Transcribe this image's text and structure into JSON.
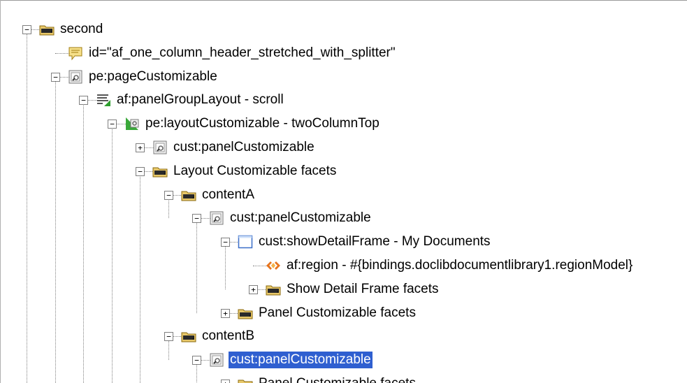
{
  "tree": {
    "nodes": [
      {
        "label": "second",
        "icon": "folder-facet-icon",
        "state": "expanded"
      },
      {
        "label": "id=\"af_one_column_header_stretched_with_splitter\"",
        "icon": "comment-icon",
        "state": "leaf"
      },
      {
        "label": "pe:pageCustomizable",
        "icon": "customizable-component-icon",
        "state": "expanded"
      },
      {
        "label": "af:panelGroupLayout - scroll",
        "icon": "panel-group-layout-icon",
        "state": "expanded"
      },
      {
        "label": "pe:layoutCustomizable - twoColumnTop",
        "icon": "layout-customizable-icon",
        "state": "expanded"
      },
      {
        "label": "cust:panelCustomizable",
        "icon": "customizable-component-icon",
        "state": "collapsed"
      },
      {
        "label": "Layout Customizable facets",
        "icon": "folder-facet-icon",
        "state": "expanded"
      },
      {
        "label": "contentA",
        "icon": "folder-facet-icon",
        "state": "expanded"
      },
      {
        "label": "cust:panelCustomizable",
        "icon": "customizable-component-icon",
        "state": "expanded"
      },
      {
        "label": "cust:showDetailFrame - My Documents",
        "icon": "show-detail-frame-icon",
        "state": "expanded"
      },
      {
        "label": "af:region - #{bindings.doclibdocumentlibrary1.regionModel}",
        "icon": "region-icon",
        "state": "leaf"
      },
      {
        "label": "Show Detail Frame facets",
        "icon": "folder-facet-icon",
        "state": "collapsed"
      },
      {
        "label": "Panel Customizable facets",
        "icon": "folder-facet-icon",
        "state": "collapsed"
      },
      {
        "label": "contentB",
        "icon": "folder-facet-icon",
        "state": "expanded"
      },
      {
        "label": "cust:panelCustomizable",
        "icon": "customizable-component-icon",
        "state": "expanded",
        "selected": true
      },
      {
        "label": "Panel Customizable facets",
        "icon": "folder-facet-icon",
        "state": "collapsed"
      }
    ]
  },
  "toggle_symbols": {
    "expanded": "−",
    "collapsed": "+"
  },
  "colors": {
    "selection": "#2f5fd0",
    "tree_lines": "#808080",
    "folder": "#e8c86a"
  }
}
